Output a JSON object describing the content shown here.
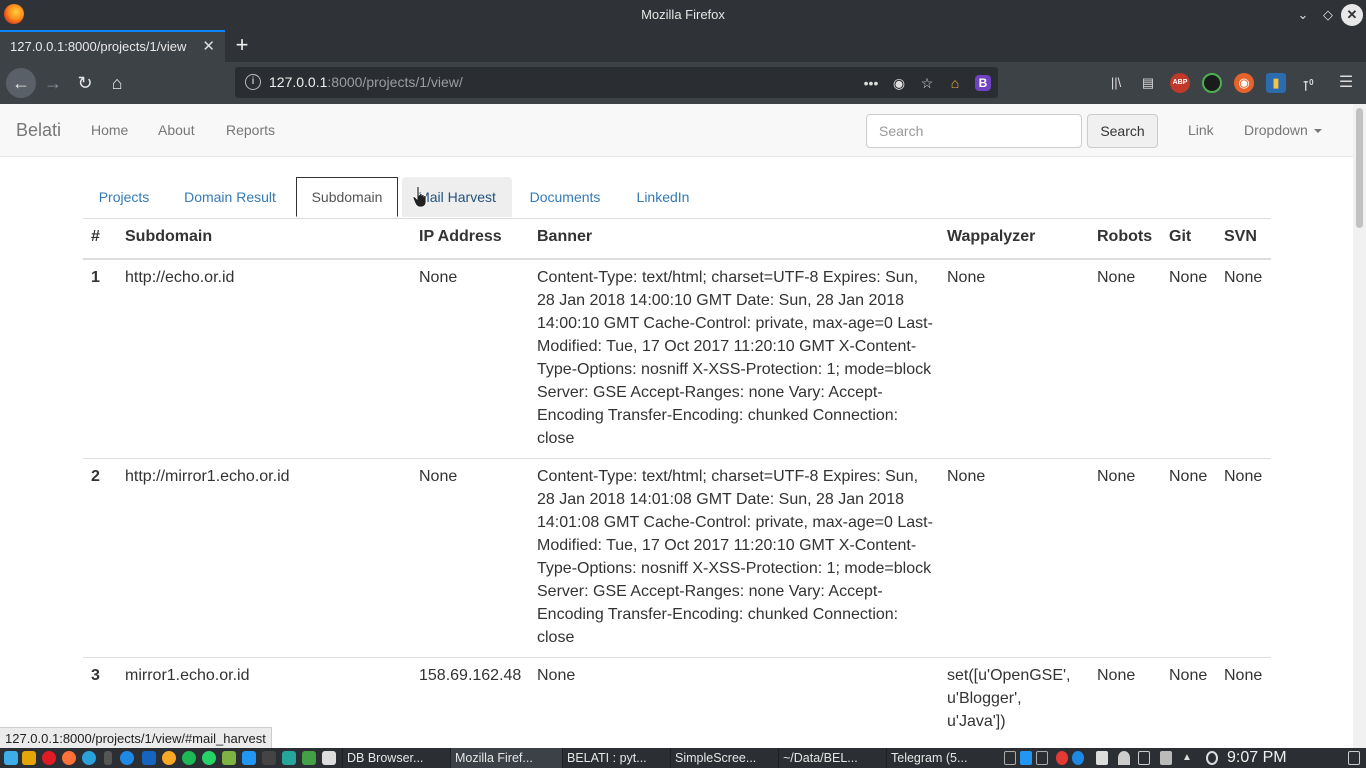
{
  "window": {
    "title": "Mozilla Firefox"
  },
  "browser": {
    "tab_title": "127.0.0.1:8000/projects/1/view",
    "url_host": "127.0.0.1",
    "url_rest": ":8000/projects/1/view/",
    "status_url": "127.0.0.1:8000/projects/1/view/#mail_harvest",
    "bootstrap_badge": "B",
    "abp_badge": "ABP",
    "badge_count": "0"
  },
  "navbar": {
    "brand": "Belati",
    "links": [
      "Home",
      "About",
      "Reports"
    ],
    "search_placeholder": "Search",
    "search_button": "Search",
    "right_links": [
      "Link",
      "Dropdown"
    ]
  },
  "tabs": [
    "Projects",
    "Domain Result",
    "Subdomain",
    "Mail Harvest",
    "Documents",
    "LinkedIn"
  ],
  "table": {
    "headers": [
      "#",
      "Subdomain",
      "IP Address",
      "Banner",
      "Wappalyzer",
      "Robots",
      "Git",
      "SVN"
    ],
    "rows": [
      {
        "num": "1",
        "subdomain": "http://echo.or.id",
        "ip": "None",
        "banner": [
          "Content-Type: text/html; charset=UTF-8 Expires: Sun,",
          "28 Jan 2018 14:00:10 GMT Date: Sun, 28 Jan 2018",
          "14:00:10 GMT Cache-Control: private, max-age=0 Last-",
          "Modified: Tue, 17 Oct 2017 11:20:10 GMT X-Content-",
          "Type-Options: nosniff X-XSS-Protection: 1; mode=block",
          "Server: GSE Accept-Ranges: none Vary: Accept-",
          "Encoding Transfer-Encoding: chunked Connection:",
          "close"
        ],
        "wappalyzer": [
          "None"
        ],
        "robots": "None",
        "git": "None",
        "svn": "None"
      },
      {
        "num": "2",
        "subdomain": "http://mirror1.echo.or.id",
        "ip": "None",
        "banner": [
          "Content-Type: text/html; charset=UTF-8 Expires: Sun,",
          "28 Jan 2018 14:01:08 GMT Date: Sun, 28 Jan 2018",
          "14:01:08 GMT Cache-Control: private, max-age=0 Last-",
          "Modified: Tue, 17 Oct 2017 11:20:10 GMT X-Content-",
          "Type-Options: nosniff X-XSS-Protection: 1; mode=block",
          "Server: GSE Accept-Ranges: none Vary: Accept-",
          "Encoding Transfer-Encoding: chunked Connection:",
          "close"
        ],
        "wappalyzer": [
          "None"
        ],
        "robots": "None",
        "git": "None",
        "svn": "None"
      },
      {
        "num": "3",
        "subdomain": "mirror1.echo.or.id",
        "ip": "158.69.162.48",
        "banner": [
          "None"
        ],
        "wappalyzer": [
          "set([u'OpenGSE',",
          "u'Blogger',",
          "u'Java'])"
        ],
        "robots": "None",
        "git": "None",
        "svn": "None"
      }
    ]
  },
  "taskbar": {
    "tasks": [
      "DB Browser...",
      "Mozilla Firef...",
      "BELATI : pyt...",
      "SimpleScree...",
      "~/Data/BEL...",
      "Telegram (5..."
    ],
    "clock": "9:07 PM"
  },
  "colors": {
    "link": "#337ab7",
    "chrome_dark": "#2f3337",
    "toolbar": "#3d4247"
  }
}
